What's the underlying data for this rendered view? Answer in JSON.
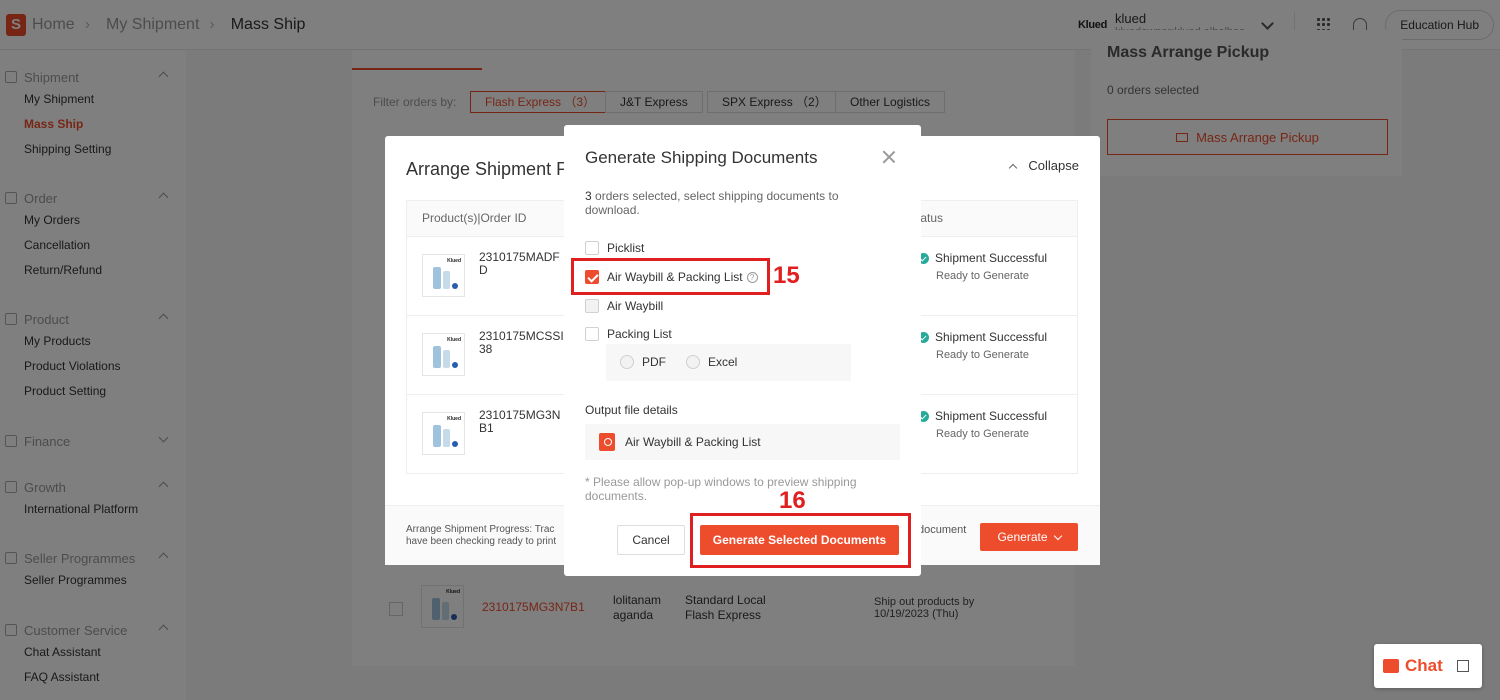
{
  "header": {
    "breadcrumbs": [
      "Home",
      "My Shipment",
      "Mass Ship"
    ],
    "brand_mini": "Klued",
    "account_name": "klued",
    "account_sub": "kluedowner:klued.albalboa",
    "edu_hub": "Education Hub"
  },
  "sidebar": {
    "sections": [
      {
        "title": "Shipment",
        "items": [
          "My Shipment",
          "Mass Ship",
          "Shipping Setting"
        ],
        "active": "Mass Ship"
      },
      {
        "title": "Order",
        "items": [
          "My Orders",
          "Cancellation",
          "Return/Refund"
        ]
      },
      {
        "title": "Product",
        "items": [
          "My Products",
          "Product Violations",
          "Product Setting"
        ]
      },
      {
        "title": "Finance",
        "items": []
      },
      {
        "title": "Growth",
        "items": [
          "International Platform"
        ]
      },
      {
        "title": "Seller Programmes",
        "items": [
          "Seller Programmes"
        ]
      },
      {
        "title": "Customer Service",
        "items": [
          "Chat Assistant",
          "FAQ Assistant"
        ]
      }
    ]
  },
  "filter": {
    "label": "Filter orders by:",
    "chips": [
      "Flash Express （3）",
      "J&T Express",
      "SPX Express （2）",
      "Other Logistics"
    ]
  },
  "mass_pickup": {
    "title": "Mass Arrange Pickup",
    "selected": "0 orders selected",
    "button": "Mass Arrange Pickup"
  },
  "bg_row": {
    "order_id": "2310175MG3N7B1",
    "buyer": "lolitanam aganda",
    "shipping": "Standard Local Flash Express",
    "ship_by_1": "Ship out products by",
    "ship_by_2": "10/19/2023 (Thu)"
  },
  "arrange": {
    "title": "Arrange Shipment P",
    "collapse": "Collapse",
    "col_product": "Product(s)|Order ID",
    "col_status": "tatus",
    "rows": [
      {
        "id_line1": "2310175MADF",
        "id_line2": "D",
        "status": "Shipment Successful",
        "sub": "Ready to Generate"
      },
      {
        "id_line1": "2310175MCSSI",
        "id_line2": "38",
        "status": "Shipment Successful",
        "sub": "Ready to Generate"
      },
      {
        "id_line1": "2310175MG3N",
        "id_line2": "B1",
        "status": "Shipment Successful",
        "sub": "Ready to Generate"
      }
    ],
    "footer_line1": "Arrange Shipment Progress: Trac",
    "footer_line2": "have been checking ready to print",
    "footer_doc": "document",
    "generate": "Generate"
  },
  "modal": {
    "title": "Generate Shipping Documents",
    "count": "3",
    "desc": " orders selected, select shipping documents to download.",
    "options": [
      {
        "label": "Picklist",
        "checked": false,
        "disabled": false
      },
      {
        "label": "Air Waybill & Packing List",
        "checked": true,
        "disabled": false
      },
      {
        "label": "Air Waybill",
        "checked": false,
        "disabled": true
      },
      {
        "label": "Packing List",
        "checked": false,
        "disabled": false
      }
    ],
    "formats": [
      "PDF",
      "Excel"
    ],
    "output_label": "Output file details",
    "output_file": "Air Waybill & Packing List",
    "note": "* Please allow pop-up windows to preview shipping documents.",
    "cancel": "Cancel",
    "generate": "Generate Selected Documents"
  },
  "annotations": {
    "step15": "15",
    "step16": "16"
  },
  "chat": {
    "label": "Chat"
  },
  "colors": {
    "accent": "#ee4d2d",
    "annotation": "#e02020",
    "success": "#26aa99"
  }
}
